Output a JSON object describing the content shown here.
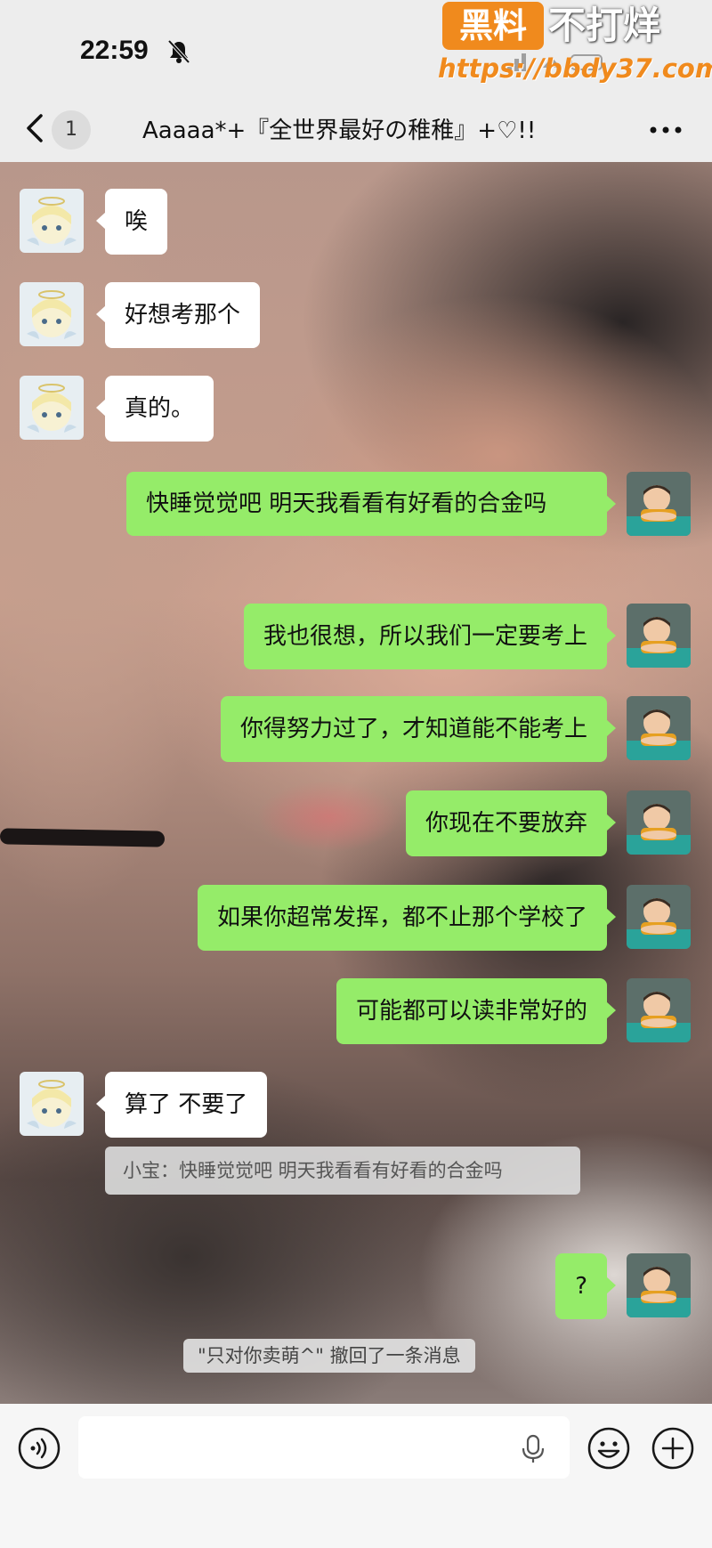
{
  "status_bar": {
    "time": "22:59"
  },
  "watermark": {
    "badge": "黑料",
    "text": "不打烊",
    "url": "https://bbdy37.com"
  },
  "nav": {
    "unread_count": "1",
    "title": "Aaaaa*+『全世界最好の稚稚』+♡!!"
  },
  "messages": [
    {
      "side": "in",
      "text": "唉"
    },
    {
      "side": "in",
      "text": "好想考那个"
    },
    {
      "side": "in",
      "text": "真的。"
    },
    {
      "side": "out",
      "text": "快睡觉觉吧 明天我看看有好看的合金吗"
    },
    {
      "side": "out",
      "text": "我也很想，所以我们一定要考上"
    },
    {
      "side": "out",
      "text": "你得努力过了，才知道能不能考上"
    },
    {
      "side": "out",
      "text": "你现在不要放弃"
    },
    {
      "side": "out",
      "text": "如果你超常发挥，都不止那个学校了"
    },
    {
      "side": "out",
      "text": "可能都可以读非常好的"
    },
    {
      "side": "in",
      "text": "算了 不要了"
    },
    {
      "side": "out",
      "text": "?"
    }
  ],
  "quote": {
    "text": "小宝：快睡觉觉吧 明天我看看有好看的合金吗"
  },
  "system_notice": {
    "text": "\"只对你卖萌^\" 撤回了一条消息"
  },
  "input": {
    "value": "",
    "placeholder": ""
  },
  "icons": {
    "bell": "bell-slash-icon",
    "back": "chevron-left-icon",
    "more": "more-dots-icon",
    "voice": "voice-icon",
    "mic": "microphone-icon",
    "emoji": "emoji-icon",
    "plus": "plus-icon"
  },
  "colors": {
    "outgoing_bubble": "#95ec69",
    "incoming_bubble": "#ffffff",
    "watermark_orange": "#f08a1d",
    "bar_background": "#ededed"
  }
}
